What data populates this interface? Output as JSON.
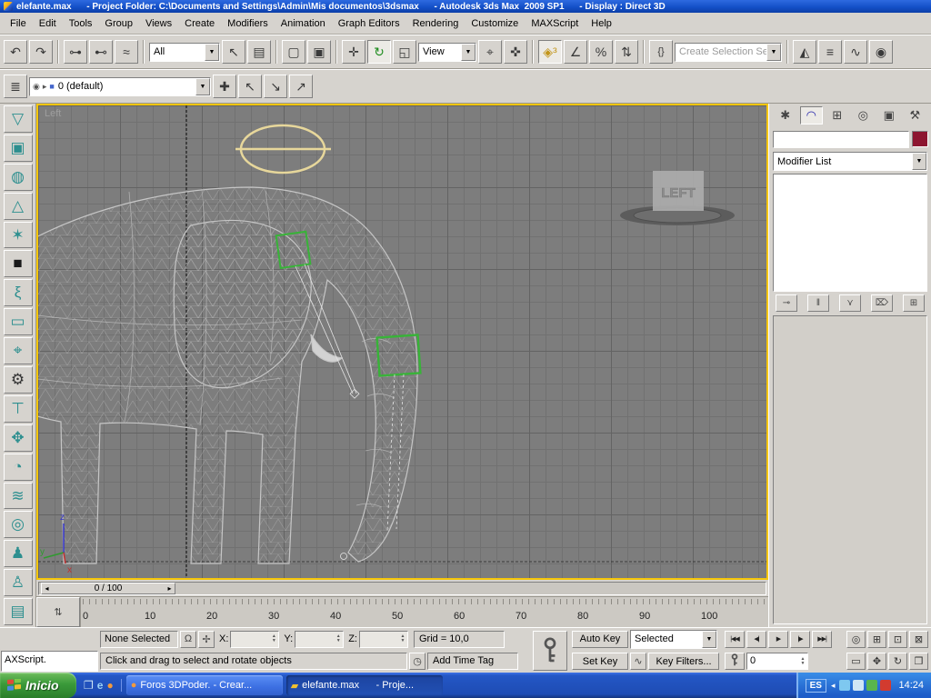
{
  "colors": {
    "titlebar_blue": "#1450c8",
    "taskbar_blue": "#2457c5",
    "start_green": "#3a9a3a",
    "viewport_bg": "#7d7d7d",
    "active_viewport_border": "#f5c60a",
    "selection_green": "#38b338",
    "gizmo_yellow": "#e7d79b",
    "object_color_swatch": "#8d1630"
  },
  "titlebar": {
    "title": "elefante.max      - Project Folder: C:\\Documents and Settings\\Admin\\Mis documentos\\3dsmax      - Autodesk 3ds Max  2009 SP1      - Display : Direct 3D"
  },
  "menubar": {
    "items": [
      "File",
      "Edit",
      "Tools",
      "Group",
      "Views",
      "Create",
      "Modifiers",
      "Animation",
      "Graph Editors",
      "Rendering",
      "Customize",
      "MAXScript",
      "Help"
    ]
  },
  "main_toolbar": {
    "history": [
      {
        "name": "undo-icon",
        "glyph": "↶"
      },
      {
        "name": "redo-icon",
        "glyph": "↷"
      }
    ],
    "linking": [
      {
        "name": "select-and-link-icon",
        "glyph": "⊶"
      },
      {
        "name": "unlink-selection-icon",
        "glyph": "⊷"
      },
      {
        "name": "bind-to-spacewarp-icon",
        "glyph": "≈"
      }
    ],
    "filter_value": "All",
    "selecting": [
      {
        "name": "select-object-icon",
        "glyph": "↖"
      },
      {
        "name": "select-by-name-icon",
        "glyph": "▤"
      }
    ],
    "region": [
      {
        "name": "rectangular-selection-region-icon",
        "glyph": "▢"
      },
      {
        "name": "window-crossing-icon",
        "glyph": "▣"
      }
    ],
    "transform": [
      {
        "name": "select-and-move-icon",
        "glyph": "✛"
      },
      {
        "name": "select-and-rotate-icon",
        "glyph": "↻",
        "active": true,
        "color": "#1e8c1e"
      },
      {
        "name": "select-and-scale-icon",
        "glyph": "◱"
      }
    ],
    "coord_value": "View",
    "center": [
      {
        "name": "use-pivot-center-icon",
        "glyph": "⌖"
      },
      {
        "name": "select-and-manipulate-icon",
        "glyph": "✜"
      }
    ],
    "snaps": [
      {
        "name": "snaps-toggle-icon",
        "glyph": "◈³",
        "active": true,
        "color": "#c2951a"
      },
      {
        "name": "angle-snap-icon",
        "glyph": "∠"
      },
      {
        "name": "percent-snap-icon",
        "glyph": "%"
      },
      {
        "name": "spinner-snap-icon",
        "glyph": "⇅"
      }
    ],
    "named_sets_glyph": "{}",
    "named_sets_placeholder": "Create Selection Set",
    "mirror_align": [
      {
        "name": "mirror-icon",
        "glyph": "◭"
      },
      {
        "name": "align-icon",
        "glyph": "≡"
      }
    ],
    "editors": [
      {
        "name": "curve-editor-icon",
        "glyph": "∿"
      },
      {
        "name": "material-editor-icon",
        "glyph": "◉"
      }
    ]
  },
  "layers_toolbar": {
    "manager_glyph": "≣",
    "combo_icons": [
      {
        "name": "layer-visibility-icon",
        "glyph": "◉",
        "color": "#555555"
      },
      {
        "name": "layer-select-icon",
        "glyph": "▸",
        "color": "#555555"
      },
      {
        "name": "layer-color-icon",
        "glyph": "■",
        "color": "#4466cc"
      }
    ],
    "current_layer": "0 (default)",
    "buttons": [
      {
        "name": "create-new-layer-icon",
        "glyph": "✚"
      },
      {
        "name": "add-selection-to-layer-icon",
        "glyph": "↖"
      },
      {
        "name": "select-objects-in-layer-icon",
        "glyph": "↘"
      },
      {
        "name": "set-current-layer-icon",
        "glyph": "↗"
      }
    ]
  },
  "left_toolbar": {
    "tools": [
      {
        "name": "cloth-tool-icon",
        "glyph": "▽"
      },
      {
        "name": "box-tool-icon",
        "glyph": "▣"
      },
      {
        "name": "sphere-tool-icon",
        "glyph": "◍"
      },
      {
        "name": "cone-tool-icon",
        "glyph": "△"
      },
      {
        "name": "star-tool-icon",
        "glyph": "✶"
      },
      {
        "name": "plane-tool-icon",
        "glyph": "■",
        "color": "#1a1a1a"
      },
      {
        "name": "spring-tool-icon",
        "glyph": "ξ"
      },
      {
        "name": "capsule-tool-icon",
        "glyph": "▭"
      },
      {
        "name": "bone-tool-icon",
        "glyph": "⌖"
      },
      {
        "name": "gear-tool-icon",
        "glyph": "⚙",
        "color": "#333333"
      },
      {
        "name": "tap-tool-icon",
        "glyph": "⊤"
      },
      {
        "name": "hand-tool-icon",
        "glyph": "✥"
      },
      {
        "name": "pot-tool-icon",
        "glyph": "◔"
      },
      {
        "name": "waves-tool-icon",
        "glyph": "≋"
      },
      {
        "name": "spiral-tool-icon",
        "glyph": "◎"
      },
      {
        "name": "biped-tool-icon",
        "glyph": "♟"
      },
      {
        "name": "figure-tool-icon",
        "glyph": "♙"
      },
      {
        "name": "door-tool-icon",
        "glyph": "▤"
      }
    ]
  },
  "viewport": {
    "label": "Left",
    "text_object": "LEFT",
    "axis_x": "x",
    "axis_y": "y",
    "axis_z": "z"
  },
  "time_slider": {
    "value": "0 / 100"
  },
  "track_bar": {
    "mini_curve_glyph": "⇅",
    "ticks": [
      "0",
      "10",
      "20",
      "30",
      "40",
      "50",
      "60",
      "70",
      "80",
      "90",
      "100"
    ]
  },
  "command_panel": {
    "tabs": [
      {
        "name": "tab-create",
        "glyph": "✱"
      },
      {
        "name": "tab-modify",
        "glyph": "◠",
        "active": true,
        "color": "#2222aa"
      },
      {
        "name": "tab-hierarchy",
        "glyph": "⊞"
      },
      {
        "name": "tab-motion",
        "glyph": "◎"
      },
      {
        "name": "tab-display",
        "glyph": "▣"
      },
      {
        "name": "tab-utilities",
        "glyph": "⚒"
      }
    ],
    "object_name_value": "",
    "modifier_list_label": "Modifier List",
    "stack_buttons": [
      {
        "name": "pin-stack-button",
        "glyph": "⊸"
      },
      {
        "name": "show-end-result-button",
        "glyph": "‖"
      },
      {
        "name": "make-unique-button",
        "glyph": "⋎"
      },
      {
        "name": "remove-modifier-button",
        "glyph": "⌦"
      },
      {
        "name": "configure-modifier-sets-button",
        "glyph": "⊞"
      }
    ]
  },
  "status_bar": {
    "maxscript_listener": "AXScript.",
    "selection_status": "None Selected",
    "coord_labels": {
      "x": "X:",
      "y": "Y:",
      "z": "Z:"
    },
    "coord_values": {
      "x": "",
      "y": "",
      "z": ""
    },
    "grid_size": "Grid = 10,0",
    "prompt": "Click and drag to select and rotate objects",
    "time_tag_glyph": "◷",
    "add_time_tag": "Add Time Tag",
    "auto_key": "Auto Key",
    "set_key": "Set Key",
    "key_mode_combo": "Selected",
    "tangent_glyph": "∿",
    "key_filters": "Key Filters...",
    "frame_number": "0",
    "playback": [
      {
        "name": "go-to-start-button",
        "glyph": "|◀◀"
      },
      {
        "name": "previous-frame-button",
        "glyph": "◀|"
      },
      {
        "name": "play-button",
        "glyph": "▶"
      },
      {
        "name": "next-frame-button",
        "glyph": "|▶"
      },
      {
        "name": "go-to-end-button",
        "glyph": "▶▶|"
      }
    ],
    "nav_row1": [
      {
        "name": "zoom-icon",
        "glyph": "◎"
      },
      {
        "name": "zoom-all-icon",
        "glyph": "⊞"
      },
      {
        "name": "zoom-extents-icon",
        "glyph": "⊡"
      },
      {
        "name": "zoom-extents-all-icon",
        "glyph": "⊠"
      }
    ],
    "nav_row2": [
      {
        "name": "region-zoom-icon",
        "glyph": "▭"
      },
      {
        "name": "pan-icon",
        "glyph": "✥"
      },
      {
        "name": "arc-rotate-icon",
        "glyph": "↻"
      },
      {
        "name": "maximize-viewport-icon",
        "glyph": "❒"
      }
    ]
  },
  "taskbar": {
    "start_label": "Inicio",
    "quick_launch": [
      {
        "name": "show-desktop-icon",
        "glyph": "❐",
        "color": "#cfe6f5"
      },
      {
        "name": "internet-explorer-icon",
        "glyph": "e",
        "color": "#9ad0f5"
      },
      {
        "name": "browser-icon",
        "glyph": "●",
        "color": "#f29a3e"
      }
    ],
    "tasks": [
      {
        "name": "task-button-foros",
        "icon_glyph": "●",
        "icon_color": "#f29a3e",
        "label": "Foros 3DPoder. - Crear..."
      },
      {
        "name": "task-button-elefante",
        "icon_glyph": "▰",
        "icon_color": "#f0c030",
        "label": "elefante.max      - Proje...",
        "active": true
      }
    ],
    "language_indicator": "ES",
    "tray_icons": [
      {
        "name": "tray-icon-1",
        "color": "#7ec8f0"
      },
      {
        "name": "tray-icon-2",
        "color": "#cfe6f5"
      },
      {
        "name": "tray-icon-3",
        "color": "#59b54d"
      },
      {
        "name": "tray-icon-4",
        "color": "#d23b2f"
      }
    ],
    "clock": "14:24"
  }
}
